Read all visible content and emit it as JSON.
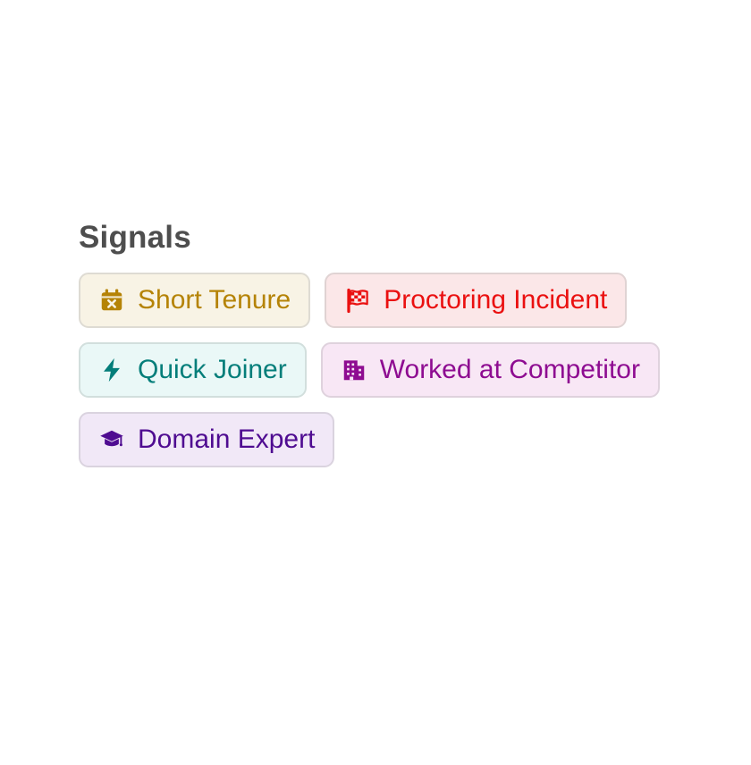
{
  "section": {
    "title": "Signals"
  },
  "signals": [
    {
      "label": "Short Tenure",
      "icon": "calendar-x-icon",
      "text_color": "#b58306",
      "bg_color": "#f8f3e5",
      "border_color": "#dedbd3"
    },
    {
      "label": "Proctoring Incident",
      "icon": "checkered-flag-icon",
      "text_color": "#ea1010",
      "bg_color": "#fbe7e8",
      "border_color": "#e0d3d3"
    },
    {
      "label": "Quick Joiner",
      "icon": "lightning-bolt-icon",
      "text_color": "#047e7a",
      "bg_color": "#eaf8f7",
      "border_color": "#d2dfdd"
    },
    {
      "label": "Worked at Competitor",
      "icon": "building-icon",
      "text_color": "#8e0c91",
      "bg_color": "#f8e7f5",
      "border_color": "#dfd2dd"
    },
    {
      "label": "Domain Expert",
      "icon": "graduation-cap-icon",
      "text_color": "#4f0c91",
      "bg_color": "#f1e8f7",
      "border_color": "#dad3df"
    }
  ]
}
